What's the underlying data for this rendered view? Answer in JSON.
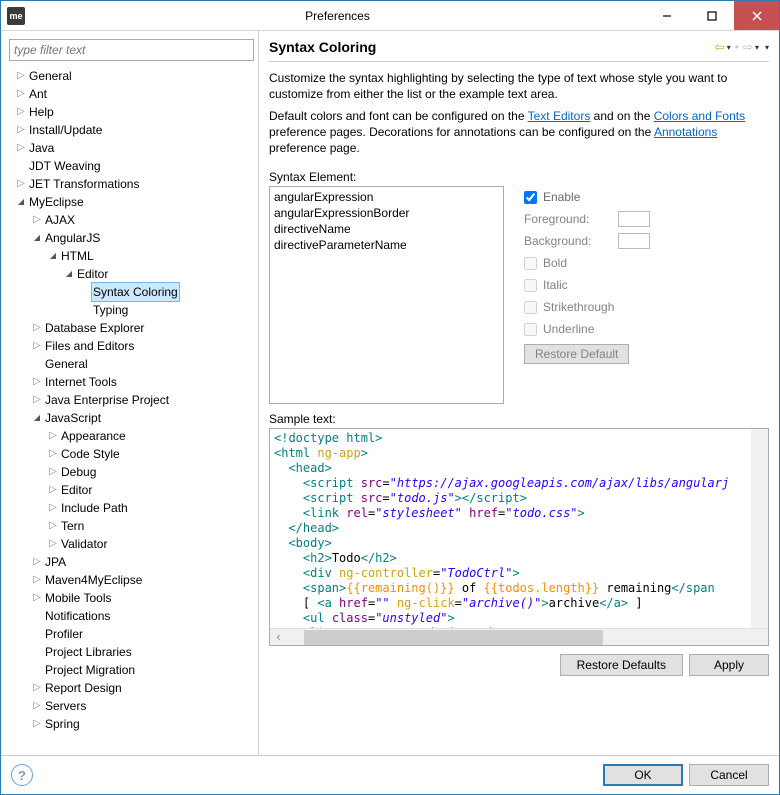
{
  "window": {
    "title": "Preferences",
    "icon_text": "me"
  },
  "filter": {
    "placeholder": "type filter text"
  },
  "tree": [
    {
      "label": "General",
      "depth": 0,
      "expandable": true,
      "open": false
    },
    {
      "label": "Ant",
      "depth": 0,
      "expandable": true,
      "open": false
    },
    {
      "label": "Help",
      "depth": 0,
      "expandable": true,
      "open": false
    },
    {
      "label": "Install/Update",
      "depth": 0,
      "expandable": true,
      "open": false
    },
    {
      "label": "Java",
      "depth": 0,
      "expandable": true,
      "open": false
    },
    {
      "label": "JDT Weaving",
      "depth": 0,
      "expandable": false
    },
    {
      "label": "JET Transformations",
      "depth": 0,
      "expandable": true,
      "open": false
    },
    {
      "label": "MyEclipse",
      "depth": 0,
      "expandable": true,
      "open": true
    },
    {
      "label": "AJAX",
      "depth": 1,
      "expandable": true,
      "open": false
    },
    {
      "label": "AngularJS",
      "depth": 1,
      "expandable": true,
      "open": true
    },
    {
      "label": "HTML",
      "depth": 2,
      "expandable": true,
      "open": true
    },
    {
      "label": "Editor",
      "depth": 3,
      "expandable": true,
      "open": true
    },
    {
      "label": "Syntax Coloring",
      "depth": 4,
      "expandable": false,
      "selected": true
    },
    {
      "label": "Typing",
      "depth": 4,
      "expandable": false
    },
    {
      "label": "Database Explorer",
      "depth": 1,
      "expandable": true,
      "open": false
    },
    {
      "label": "Files and Editors",
      "depth": 1,
      "expandable": true,
      "open": false
    },
    {
      "label": "General",
      "depth": 1,
      "expandable": false
    },
    {
      "label": "Internet Tools",
      "depth": 1,
      "expandable": true,
      "open": false
    },
    {
      "label": "Java Enterprise Project",
      "depth": 1,
      "expandable": true,
      "open": false
    },
    {
      "label": "JavaScript",
      "depth": 1,
      "expandable": true,
      "open": true
    },
    {
      "label": "Appearance",
      "depth": 2,
      "expandable": true,
      "open": false
    },
    {
      "label": "Code Style",
      "depth": 2,
      "expandable": true,
      "open": false
    },
    {
      "label": "Debug",
      "depth": 2,
      "expandable": true,
      "open": false
    },
    {
      "label": "Editor",
      "depth": 2,
      "expandable": true,
      "open": false
    },
    {
      "label": "Include Path",
      "depth": 2,
      "expandable": true,
      "open": false
    },
    {
      "label": "Tern",
      "depth": 2,
      "expandable": true,
      "open": false
    },
    {
      "label": "Validator",
      "depth": 2,
      "expandable": true,
      "open": false
    },
    {
      "label": "JPA",
      "depth": 1,
      "expandable": true,
      "open": false
    },
    {
      "label": "Maven4MyEclipse",
      "depth": 1,
      "expandable": true,
      "open": false
    },
    {
      "label": "Mobile Tools",
      "depth": 1,
      "expandable": true,
      "open": false
    },
    {
      "label": "Notifications",
      "depth": 1,
      "expandable": false
    },
    {
      "label": "Profiler",
      "depth": 1,
      "expandable": false
    },
    {
      "label": "Project Libraries",
      "depth": 1,
      "expandable": false
    },
    {
      "label": "Project Migration",
      "depth": 1,
      "expandable": false
    },
    {
      "label": "Report Design",
      "depth": 1,
      "expandable": true,
      "open": false
    },
    {
      "label": "Servers",
      "depth": 1,
      "expandable": true,
      "open": false
    },
    {
      "label": "Spring",
      "depth": 1,
      "expandable": true,
      "open": false
    }
  ],
  "page": {
    "title": "Syntax Coloring",
    "intro1": "Customize the syntax highlighting by selecting the type of text whose style you want to customize from either the list or the example text area.",
    "intro2a": "Default colors and font can be configured on the ",
    "link1": "Text Editors",
    "intro2b": " and on the ",
    "link2": "Colors and Fonts",
    "intro2c": " preference pages.  Decorations for annotations can be configured on the ",
    "link3": "Annotations",
    "intro2d": " preference page.",
    "syntax_label": "Syntax Element:",
    "elements": [
      "angularExpression",
      "angularExpressionBorder",
      "directiveName",
      "directiveParameterName"
    ],
    "enable": "Enable",
    "foreground": "Foreground:",
    "background": "Background:",
    "bold": "Bold",
    "italic": "Italic",
    "strike": "Strikethrough",
    "underline": "Underline",
    "restore_default": "Restore Default",
    "sample_label": "Sample text:",
    "restore_defaults": "Restore Defaults",
    "apply": "Apply"
  },
  "footer": {
    "ok": "OK",
    "cancel": "Cancel"
  }
}
